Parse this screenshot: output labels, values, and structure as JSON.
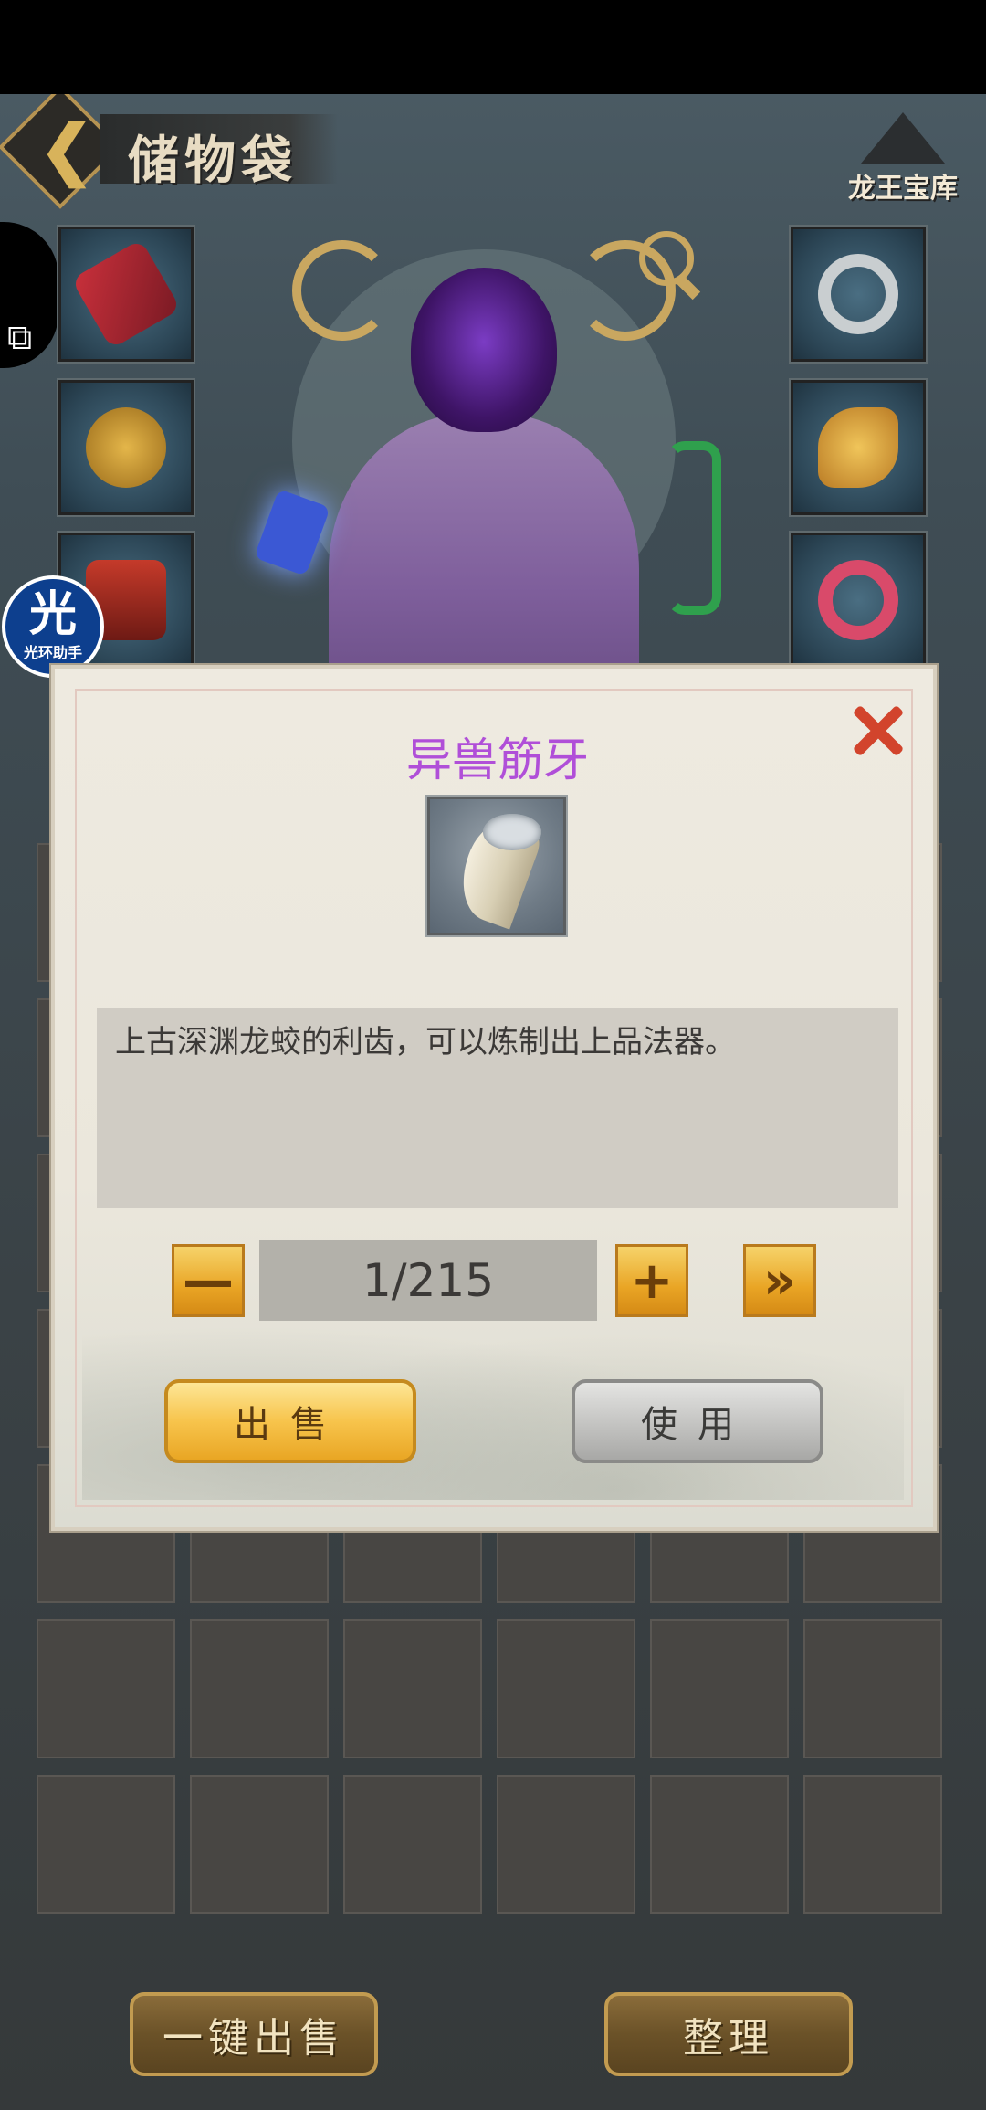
{
  "header": {
    "title": "储物袋",
    "treasury_label": "龙王宝库"
  },
  "helper": {
    "big": "光",
    "small": "光环助手"
  },
  "dialog": {
    "item_name": "异兽筋牙",
    "item_name_color": "#b04fd8",
    "description": "上古深渊龙蛟的利齿，可以炼制出上品法器。",
    "quantity": "1/215",
    "minus_label": "—",
    "plus_label": "+",
    "max_label": "»",
    "sell_label": "出售",
    "use_label": "使用"
  },
  "footer": {
    "sell_all_label": "一键出售",
    "sort_label": "整理"
  },
  "equipment_left": [
    "sword-icon",
    "helmet-icon",
    "armor-icon"
  ],
  "equipment_right": [
    "ring-icon",
    "jade-pendant-icon",
    "bracelet-icon"
  ]
}
